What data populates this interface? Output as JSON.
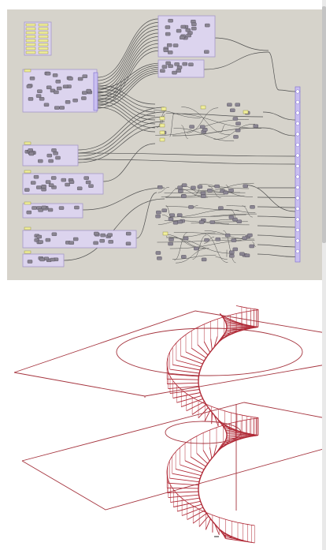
{
  "colors": {
    "canvas_bg": "#d6d3cb",
    "group_fill": "#dcd4ee",
    "group_stroke": "#a698c8",
    "component_fill": "#8a8592",
    "component_stroke": "#4b4754",
    "wire": "#505050",
    "param_fill": "#f1ef9c",
    "param_stroke": "#8a8530",
    "collector_bar": "#c9bff0",
    "collector_stroke": "#7c6bd0",
    "model_line": "#b02a37",
    "plane_line": "#a5343e"
  },
  "icons": {
    "canvas": "node-graph-canvas",
    "viewport": "3d-wireframe-viewport",
    "node": "component-node",
    "param": "number-slider",
    "cursor": "cursor-mark"
  },
  "viewport": {
    "model": "spiral-staircase-wireframe"
  }
}
